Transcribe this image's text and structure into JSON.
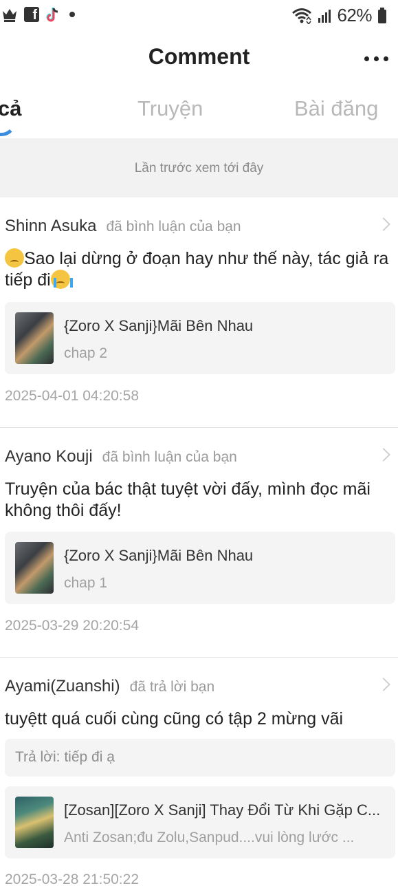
{
  "status_bar": {
    "battery": "62%",
    "left_icons": [
      "crown-icon",
      "facebook-icon",
      "tiktok-icon",
      "dot-icon"
    ],
    "right_icons": [
      "wifi-icon",
      "signal-icon",
      "battery-icon"
    ]
  },
  "header": {
    "title": "Comment"
  },
  "tabs": [
    {
      "label": "t cả",
      "active": true
    },
    {
      "label": "Truyện",
      "active": false
    },
    {
      "label": "Bài đăng",
      "active": false
    }
  ],
  "banner": {
    "text": "Lần trước xem tới đây"
  },
  "comments": [
    {
      "user": "Shinn Asuka",
      "action": "đã bình luận của bạn",
      "text_line1": "Sao lại dừng ở đoạn hay như thế này, tác giả ra",
      "text_line2": "tiếp đi",
      "story_title": "{Zoro X Sanji}Mãi Bên Nhau",
      "story_sub": "chap 2",
      "time": "2025-04-01 04:20:58"
    },
    {
      "user": "Ayano Kouji",
      "action": "đã bình luận của bạn",
      "text_line1": "Truyện của bác thật tuyệt vời đấy, mình đọc mãi",
      "text_line2": "không thôi đấy!",
      "story_title": "{Zoro X Sanji}Mãi Bên Nhau",
      "story_sub": "chap 1",
      "time": "2025-03-29 20:20:54"
    },
    {
      "user": "Ayami(Zuanshi)",
      "action": "đã trả lời bạn",
      "text_line1": "tuyệtt quá cuối cùng cũng có tập 2 mừng vãi",
      "reply": "Trả lời: tiếp đi ạ",
      "story_title": "[Zosan][Zoro X Sanji] Thay Đổi Từ Khi Gặp C...",
      "story_sub": "Anti Zosan;đu Zolu,Sanpud....vui lòng lước ...",
      "time": "2025-03-28 21:50:22"
    }
  ],
  "colors": {
    "accent": "#3a8fe0",
    "muted": "#a0a0a0",
    "card_bg": "#f4f4f4"
  }
}
